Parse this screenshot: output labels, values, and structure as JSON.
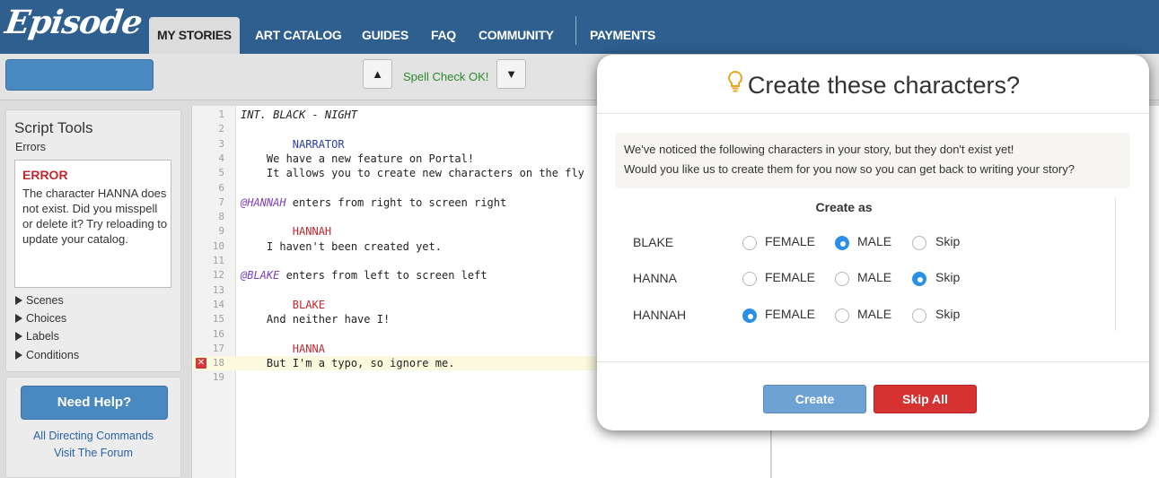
{
  "nav": {
    "logo": "Episode",
    "tabs": [
      {
        "label": "MY STORIES"
      },
      {
        "label": "ART CATALOG"
      },
      {
        "label": "GUIDES"
      },
      {
        "label": "FAQ"
      },
      {
        "label": "COMMUNITY"
      },
      {
        "label": "PAYMENTS"
      }
    ],
    "active_tab": "MY STORIES"
  },
  "toolbar": {
    "up_arrow": "▲",
    "down_arrow": "▼",
    "spell_status": "Spell Check OK!"
  },
  "sidebar": {
    "title": "Script Tools",
    "errors_label": "Errors",
    "error_title": "ERROR",
    "error_message": "The character HANNA does not exist. Did you misspell or delete it? Try reloading to update your catalog.",
    "tools": [
      "Scenes",
      "Choices",
      "Labels",
      "Conditions"
    ],
    "help_button": "Need Help?",
    "links": [
      "All Directing Commands",
      "Visit The Forum"
    ]
  },
  "editor": {
    "lines": [
      {
        "n": "1",
        "text": "INT. BLACK - NIGHT",
        "style": "italic"
      },
      {
        "n": "2",
        "text": ""
      },
      {
        "n": "3",
        "text": "        NARRATOR",
        "style": "name-blue"
      },
      {
        "n": "4",
        "text": "    We have a new feature on Portal!"
      },
      {
        "n": "5",
        "text": "    It allows you to create new characters on the fly"
      },
      {
        "n": "6",
        "text": ""
      },
      {
        "n": "7",
        "at": "@HANNAH",
        "text": " enters from right to screen right"
      },
      {
        "n": "8",
        "text": ""
      },
      {
        "n": "9",
        "text": "        HANNAH",
        "style": "name-red"
      },
      {
        "n": "10",
        "text": "    I haven't been created yet."
      },
      {
        "n": "11",
        "text": ""
      },
      {
        "n": "12",
        "at": "@BLAKE",
        "text": " enters from left to screen left"
      },
      {
        "n": "13",
        "text": ""
      },
      {
        "n": "14",
        "text": "        BLAKE",
        "style": "name-red"
      },
      {
        "n": "15",
        "text": "    And neither have I!"
      },
      {
        "n": "16",
        "text": ""
      },
      {
        "n": "17",
        "text": "        HANNA",
        "style": "name-red"
      },
      {
        "n": "18",
        "text": "    But I'm a typo, so ignore me.",
        "error": true
      },
      {
        "n": "19",
        "text": ""
      }
    ],
    "error_marker": "✕"
  },
  "modal": {
    "title": "Create these characters?",
    "bulb_icon": "💡",
    "notice_line1": "We've noticed the following characters in your story, but they don't exist yet!",
    "notice_line2": "Would you like us to create them for you now so you can get back to writing your story?",
    "create_as_label": "Create as",
    "options": [
      "FEMALE",
      "MALE",
      "Skip"
    ],
    "characters": [
      {
        "name": "BLAKE",
        "selected": "MALE"
      },
      {
        "name": "HANNA",
        "selected": "Skip"
      },
      {
        "name": "HANNAH",
        "selected": "FEMALE"
      }
    ],
    "create_button": "Create",
    "skip_all_button": "Skip All"
  },
  "colors": {
    "nav_bg": "#2e5f8e",
    "accent_blue": "#4a88c0",
    "error_red": "#c0282d",
    "radio_selected": "#2b8fe6",
    "skip_all_red": "#d63232"
  }
}
